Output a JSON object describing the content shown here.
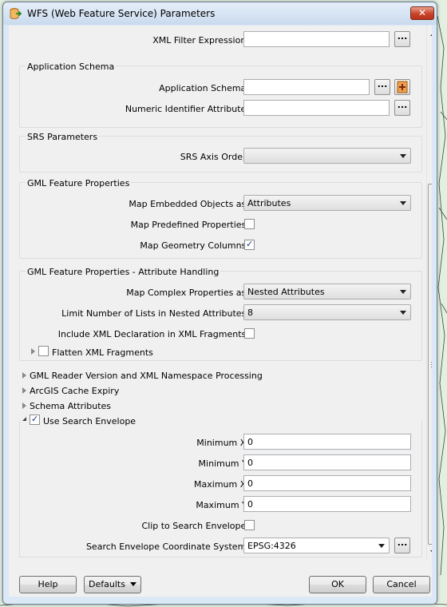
{
  "window": {
    "title": "WFS (Web Feature Service) Parameters",
    "close_label": "✕"
  },
  "xml_filter": {
    "label": "XML Filter Expression:",
    "value": "",
    "ellipsis": "..."
  },
  "application_schema": {
    "title": "Application Schema",
    "schema_label": "Application Schema:",
    "schema_value": "",
    "numeric_id_label": "Numeric Identifier Attribute:",
    "numeric_id_value": "",
    "ellipsis": "..."
  },
  "srs": {
    "title": "SRS Parameters",
    "axis_order_label": "SRS Axis Order:",
    "axis_order_value": ""
  },
  "gml": {
    "title": "GML Feature Properties",
    "embedded_label": "Map Embedded Objects as:",
    "embedded_value": "Attributes",
    "predefined_label": "Map Predefined Properties:",
    "predefined_checked": false,
    "geometry_label": "Map Geometry Columns:",
    "geometry_checked": true
  },
  "gml_attr": {
    "title": "GML Feature Properties - Attribute Handling",
    "complex_label": "Map Complex Properties as:",
    "complex_value": "Nested Attributes",
    "limit_label": "Limit Number of Lists in Nested Attributes:",
    "limit_value": "8",
    "xml_decl_label": "Include XML Declaration in XML Fragments:",
    "xml_decl_checked": false,
    "flatten_label": "Flatten XML Fragments",
    "flatten_checked": false
  },
  "sections": [
    "GML Reader Version and XML Namespace Processing",
    "ArcGIS Cache Expiry",
    "Schema Attributes"
  ],
  "envelope": {
    "title": "Use Search Envelope",
    "checked": true,
    "min_x_label": "Minimum X:",
    "min_x": "0",
    "min_y_label": "Minimum Y:",
    "min_y": "0",
    "max_x_label": "Maximum X:",
    "max_x": "0",
    "max_y_label": "Maximum Y:",
    "max_y": "0",
    "clip_label": "Clip to Search Envelope:",
    "clip_checked": false,
    "coord_label": "Search Envelope Coordinate System:",
    "coord_value": "EPSG:4326",
    "ellipsis": "..."
  },
  "buttons": {
    "help": "Help",
    "defaults": "Defaults",
    "ok": "OK",
    "cancel": "Cancel"
  },
  "colors": {
    "check": "#1b3a8a",
    "close": "#c9442a"
  }
}
